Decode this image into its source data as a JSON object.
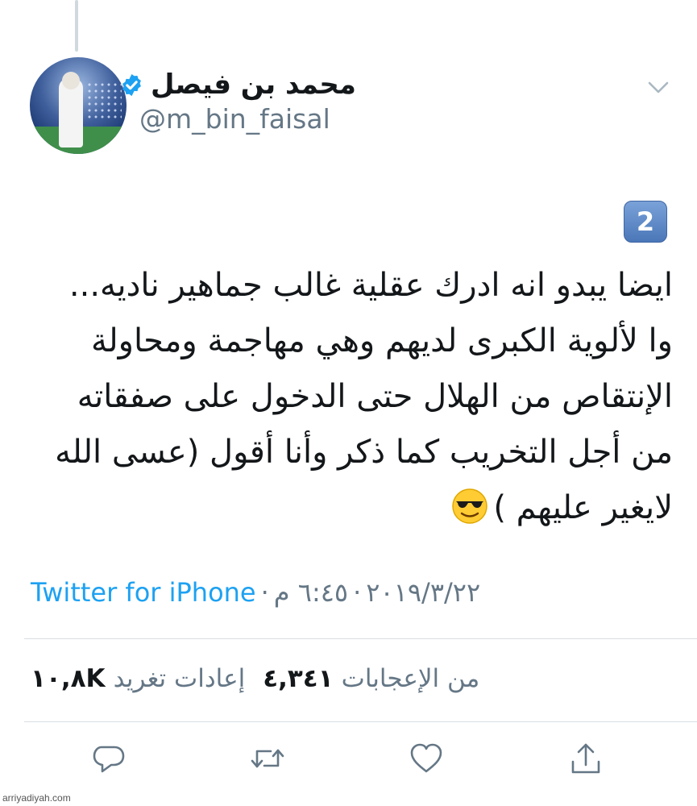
{
  "tweet": {
    "display_name": "محمد بن فيصل",
    "handle": "@m_bin_faisal",
    "number_badge": "2",
    "text_lines": [
      "ايضا يبدو انه ادرك عقلية غالب جماهير ناديه...",
      "وا لألوية الكبرى لديهم وهي مهاجمة ومحاولة",
      "الإنتقاص من الهلال حتى الدخول على صفقاته",
      "من أجل التخريب كما ذكر وأنا أقول (عسى الله",
      "لايغير عليهم )"
    ],
    "emoji": "smiling-face-with-sunglasses",
    "time": "٦:٤٥ م",
    "date": "٢٠١٩/٣/٢٢",
    "separator": "·",
    "source": "Twitter for iPhone"
  },
  "stats": {
    "retweets_count": "١٠,٨K",
    "retweets_label": "إعادات تغريد",
    "likes_count": "٤,٣٤١",
    "likes_label": "من الإعجابات"
  },
  "icons": {
    "verified": "verified-badge-icon",
    "menu": "chevron-down-icon",
    "reply": "reply-icon",
    "retweet": "retweet-icon",
    "like": "heart-icon",
    "share": "share-icon"
  },
  "colors": {
    "accent": "#1da1f2",
    "muted": "#657786",
    "text": "#14171a"
  },
  "watermark": "arriyadiyah.com"
}
